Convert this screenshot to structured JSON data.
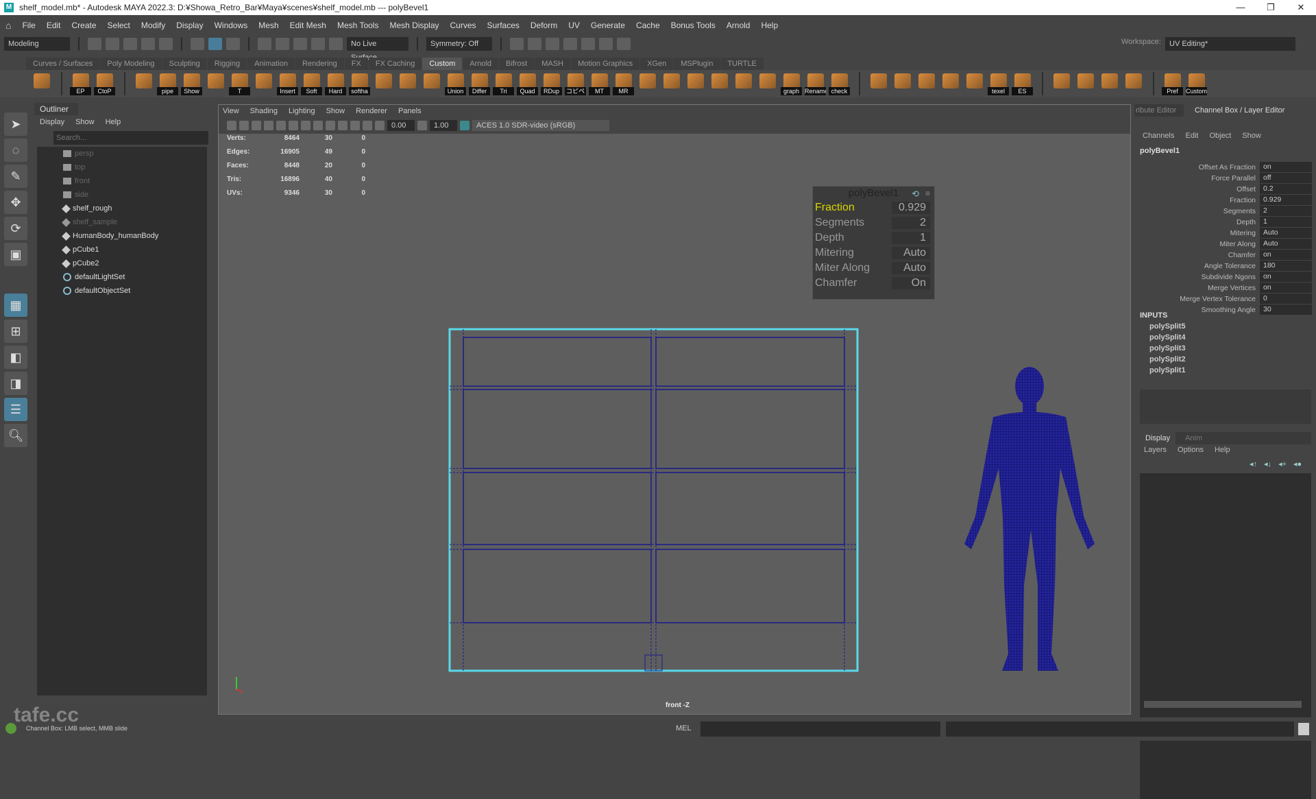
{
  "title": "shelf_model.mb* - Autodesk MAYA 2022.3: D:¥Showa_Retro_Bar¥Maya¥scenes¥shelf_model.mb  ---  polyBevel1",
  "window_controls": [
    "—",
    "❐",
    "✕"
  ],
  "menus": [
    "File",
    "Edit",
    "Create",
    "Select",
    "Modify",
    "Display",
    "Windows",
    "Mesh",
    "Edit Mesh",
    "Mesh Tools",
    "Mesh Display",
    "Curves",
    "Surfaces",
    "Deform",
    "UV",
    "Generate",
    "Cache",
    "Bonus Tools",
    "Arnold",
    "Help"
  ],
  "status": {
    "mode": "Modeling",
    "live_surface": "No Live Surface",
    "symmetry": "Symmetry: Off",
    "workspace_label": "Workspace:",
    "workspace": "UV Editing*"
  },
  "shelf_tabs": [
    "Curves / Surfaces",
    "Poly Modeling",
    "Sculpting",
    "Rigging",
    "Animation",
    "Rendering",
    "FX",
    "FX Caching",
    "Custom",
    "Arnold",
    "Bifrost",
    "MASH",
    "Motion Graphics",
    "XGen",
    "MSPlugin",
    "TURTLE"
  ],
  "shelf_active": "Custom",
  "shelf_groups": [
    [
      ""
    ],
    [
      "EP",
      "CtoP"
    ],
    [
      "",
      "pipe",
      "Show",
      "",
      "T",
      "",
      "Insert",
      "Soft",
      "Hard",
      "softha",
      "",
      "",
      "",
      "Union",
      "Differ",
      "Tri",
      "Quad",
      "RDup",
      "コピペ",
      "MT",
      "MR",
      "",
      "",
      "",
      "",
      "",
      "",
      "graph",
      "Rename",
      "check"
    ],
    [
      "",
      "",
      "",
      "",
      "",
      "texel",
      "ES"
    ],
    [
      "",
      "",
      "",
      ""
    ],
    [
      "Pref",
      "Custom"
    ]
  ],
  "outliner": {
    "title": "Outliner",
    "menu": [
      "Display",
      "Show",
      "Help"
    ],
    "search_placeholder": "Search...",
    "items": [
      {
        "name": "persp",
        "type": "camera",
        "dim": true
      },
      {
        "name": "top",
        "type": "camera",
        "dim": true
      },
      {
        "name": "front",
        "type": "camera",
        "dim": true
      },
      {
        "name": "side",
        "type": "camera",
        "dim": true
      },
      {
        "name": "shelf_rough",
        "type": "transform",
        "dim": false
      },
      {
        "name": "shelf_sample",
        "type": "transform",
        "dim": true
      },
      {
        "name": "HumanBody_humanBody",
        "type": "transform",
        "dim": false
      },
      {
        "name": "pCube1",
        "type": "transform",
        "dim": false
      },
      {
        "name": "pCube2",
        "type": "transform",
        "dim": false
      },
      {
        "name": "defaultLightSet",
        "type": "set",
        "dim": false
      },
      {
        "name": "defaultObjectSet",
        "type": "set",
        "dim": false
      }
    ]
  },
  "viewport": {
    "menu": [
      "View",
      "Shading",
      "Lighting",
      "Show",
      "Renderer",
      "Panels"
    ],
    "exposure": "0.00",
    "gamma": "1.00",
    "color_space": "ACES 1.0 SDR-video (sRGB)",
    "camera_label": "front -Z",
    "hud": [
      [
        "Verts:",
        "8464",
        "30",
        "0"
      ],
      [
        "Edges:",
        "16905",
        "49",
        "0"
      ],
      [
        "Faces:",
        "8448",
        "20",
        "0"
      ],
      [
        "Tris:",
        "16896",
        "40",
        "0"
      ],
      [
        "UVs:",
        "9346",
        "30",
        "0"
      ]
    ],
    "mesh_color": "#1a1a8c",
    "selection_color": "#5ad8ea"
  },
  "bevel_popup": {
    "title": "polyBevel1",
    "rows": [
      [
        "Fraction",
        "0.929"
      ],
      [
        "Segments",
        "2"
      ],
      [
        "Depth",
        "1"
      ],
      [
        "Mitering",
        "Auto"
      ],
      [
        "Miter Along",
        "Auto"
      ],
      [
        "Chamfer",
        "On"
      ]
    ]
  },
  "channel_box": {
    "tabs": [
      "ribute Editor",
      "Channel Box / Layer Editor"
    ],
    "menu": [
      "Channels",
      "Edit",
      "Object",
      "Show"
    ],
    "node": "polyBevel1",
    "attrs": [
      [
        "Offset As Fraction",
        "on"
      ],
      [
        "Force Parallel",
        "off"
      ],
      [
        "Offset",
        "0.2"
      ],
      [
        "Fraction",
        "0.929"
      ],
      [
        "Segments",
        "2"
      ],
      [
        "Depth",
        "1"
      ],
      [
        "Mitering",
        "Auto"
      ],
      [
        "Miter Along",
        "Auto"
      ],
      [
        "Chamfer",
        "on"
      ],
      [
        "Angle Tolerance",
        "180"
      ],
      [
        "Subdivide Ngons",
        "on"
      ],
      [
        "Merge Vertices",
        "on"
      ],
      [
        "Merge Vertex Tolerance",
        "0"
      ],
      [
        "Smoothing Angle",
        "30"
      ]
    ],
    "inputs_label": "INPUTS",
    "inputs": [
      "polySplit5",
      "polySplit4",
      "polySplit3",
      "polySplit2",
      "polySplit1"
    ]
  },
  "layer_editor": {
    "tabs": [
      "Display",
      "Anim"
    ],
    "menu": [
      "Layers",
      "Options",
      "Help"
    ]
  },
  "help_line": "Channel Box: LMB select, MMB slide",
  "command_line": {
    "label": "MEL"
  },
  "watermark": "tafe.cc"
}
